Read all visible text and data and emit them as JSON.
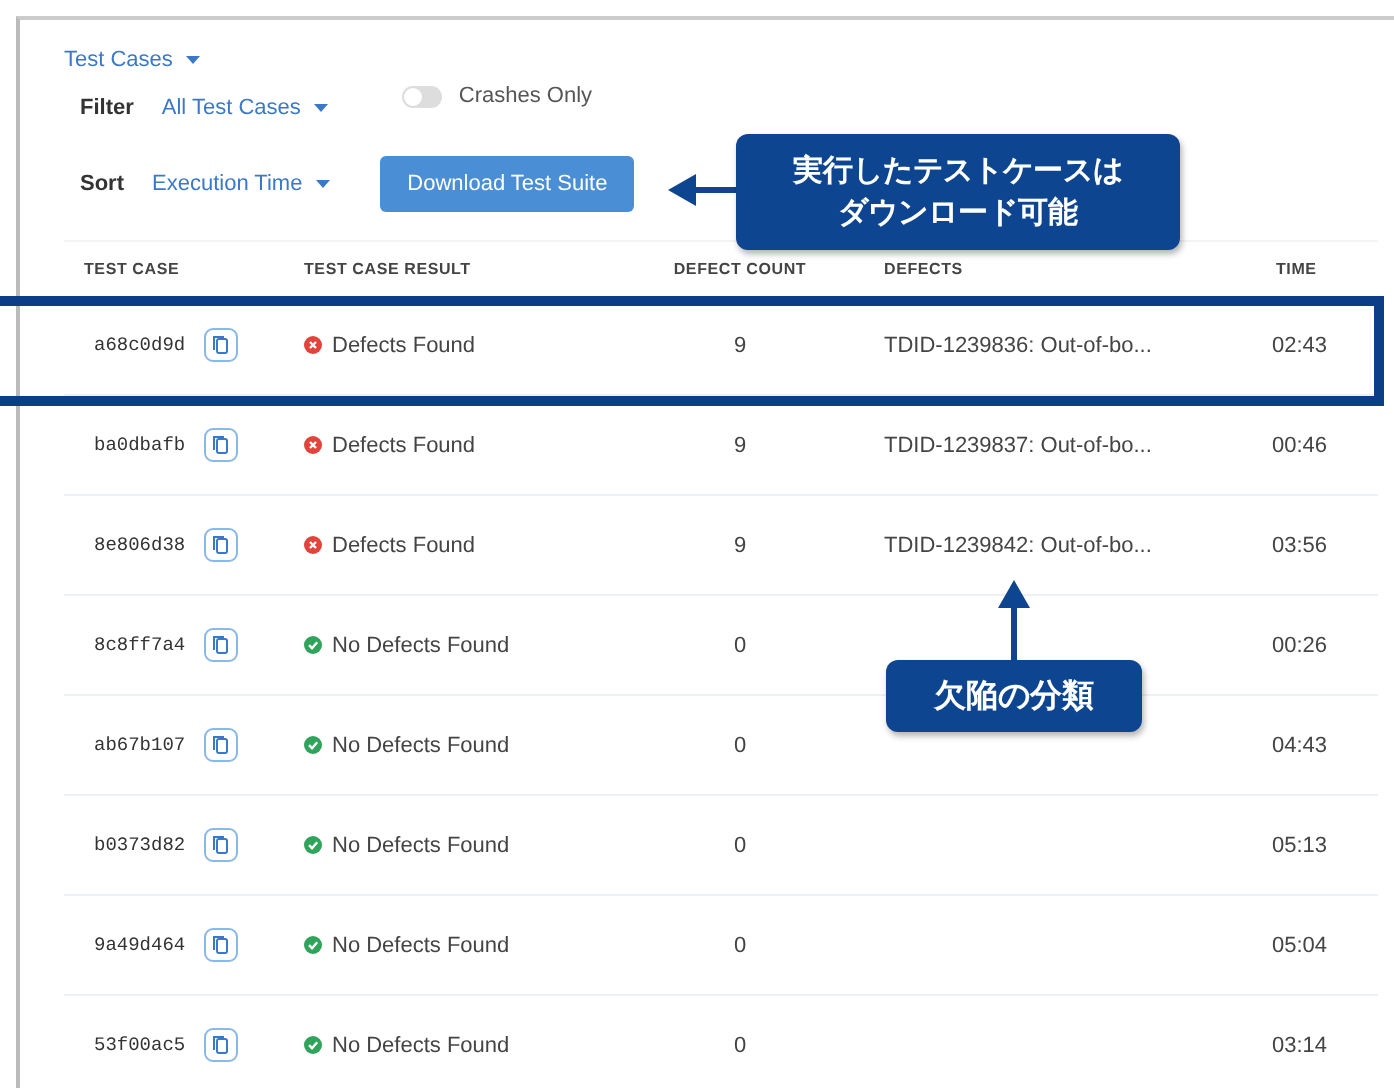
{
  "view_selector": {
    "label": "Test Cases"
  },
  "filter": {
    "label": "Filter",
    "value": "All Test Cases"
  },
  "crashes_toggle": {
    "label": "Crashes Only",
    "on": false
  },
  "sort": {
    "label": "Sort",
    "value": "Execution Time"
  },
  "download_button": "Download Test Suite",
  "table": {
    "columns": [
      "TEST CASE",
      "TEST CASE RESULT",
      "DEFECT COUNT",
      "DEFECTS",
      "TIME"
    ],
    "rows": [
      {
        "id": "a68c0d9d",
        "kind": "fail",
        "result": "Defects Found",
        "count": "9",
        "defects": "TDID-1239836: Out-of-bo...",
        "time": "02:43"
      },
      {
        "id": "ba0dbafb",
        "kind": "fail",
        "result": "Defects Found",
        "count": "9",
        "defects": "TDID-1239837: Out-of-bo...",
        "time": "00:46"
      },
      {
        "id": "8e806d38",
        "kind": "fail",
        "result": "Defects Found",
        "count": "9",
        "defects": "TDID-1239842: Out-of-bo...",
        "time": "03:56"
      },
      {
        "id": "8c8ff7a4",
        "kind": "pass",
        "result": "No Defects Found",
        "count": "0",
        "time": "00:26"
      },
      {
        "id": "ab67b107",
        "kind": "pass",
        "result": "No Defects Found",
        "count": "0",
        "time": "04:43"
      },
      {
        "id": "b0373d82",
        "kind": "pass",
        "result": "No Defects Found",
        "count": "0",
        "time": "05:13"
      },
      {
        "id": "9a49d464",
        "kind": "pass",
        "result": "No Defects Found",
        "count": "0",
        "time": "05:04"
      },
      {
        "id": "53f00ac5",
        "kind": "pass",
        "result": "No Defects Found",
        "count": "0",
        "time": "03:14"
      }
    ]
  },
  "annotations": [
    {
      "kind": "left",
      "text": "実行したテストケースはダウンロード可能"
    },
    {
      "kind": "up",
      "text": "欠陥の分類"
    }
  ]
}
